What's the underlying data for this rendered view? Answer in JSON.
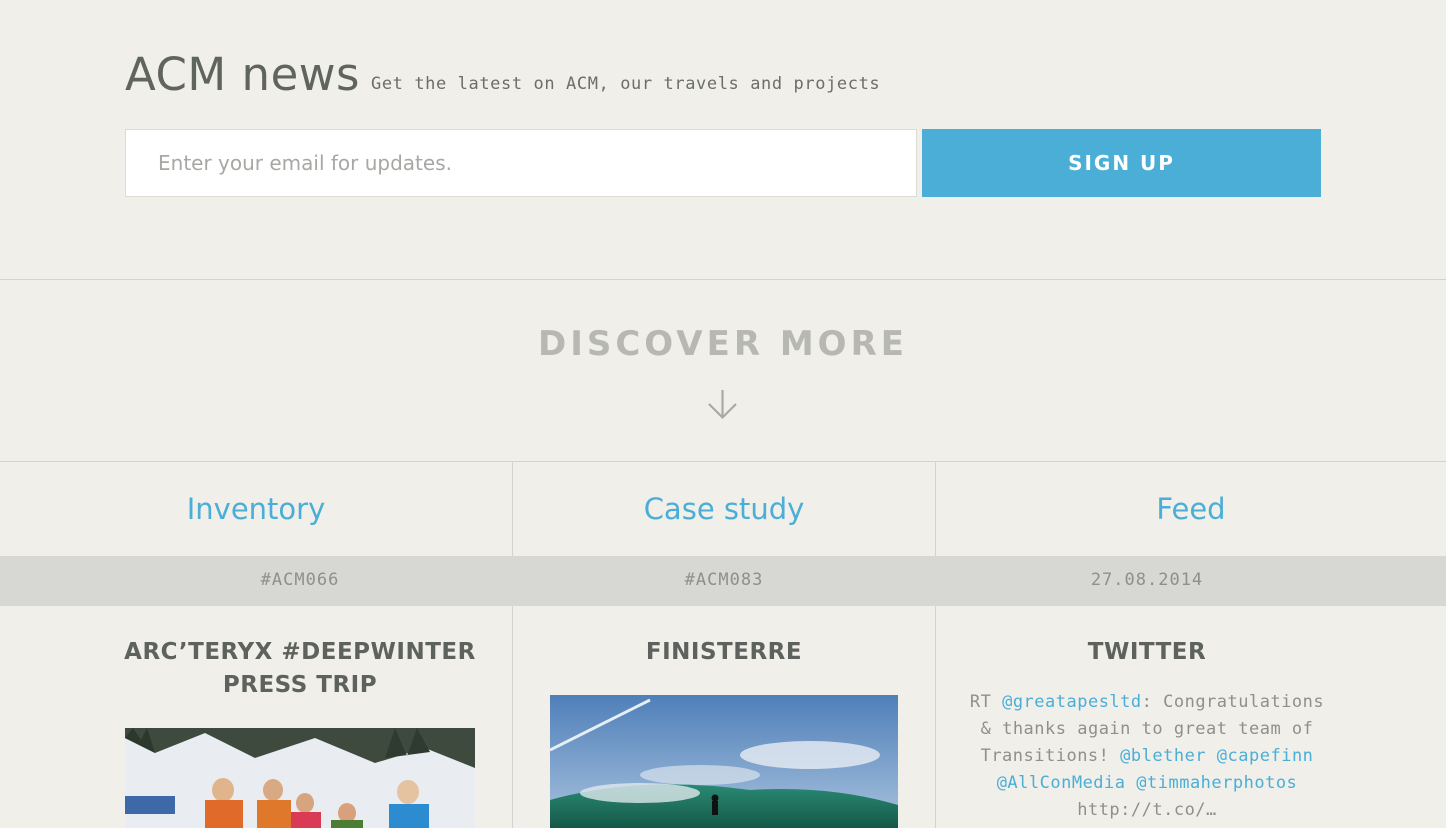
{
  "news": {
    "title": "ACM news",
    "subtitle": "Get the latest on ACM, our travels and projects",
    "email_placeholder": "Enter your email for updates.",
    "signup_label": "SIGN UP"
  },
  "discover": {
    "label": "DISCOVER MORE",
    "icon": "arrow-down-icon"
  },
  "columns": [
    {
      "heading": "Inventory",
      "tag": "#ACM066",
      "title_line1": "ARC’TERYX #DEEPWINTER",
      "title_line2": "PRESS TRIP"
    },
    {
      "heading": "Case study",
      "tag": "#ACM083",
      "title_line1": "FINISTERRE",
      "title_line2": ""
    },
    {
      "heading": "Feed",
      "tag": "27.08.2014",
      "title_line1": "TWITTER",
      "title_line2": ""
    }
  ],
  "tweet": {
    "prefix": "RT ",
    "mention1": "@greatapesltd",
    "text1": ": Congratulations & thanks again to great team of Transitions!",
    "mention2": "@blether",
    "mention3": "@capefinn",
    "mention4": "@AllConMedia",
    "mention5": "@timmaherphotos",
    "link": "http://t.co/…"
  },
  "colors": {
    "accent": "#4aaed7",
    "background": "#f0efea",
    "band": "#d7d7d4",
    "heading_text": "#60645f",
    "muted_text": "#8e908c"
  }
}
